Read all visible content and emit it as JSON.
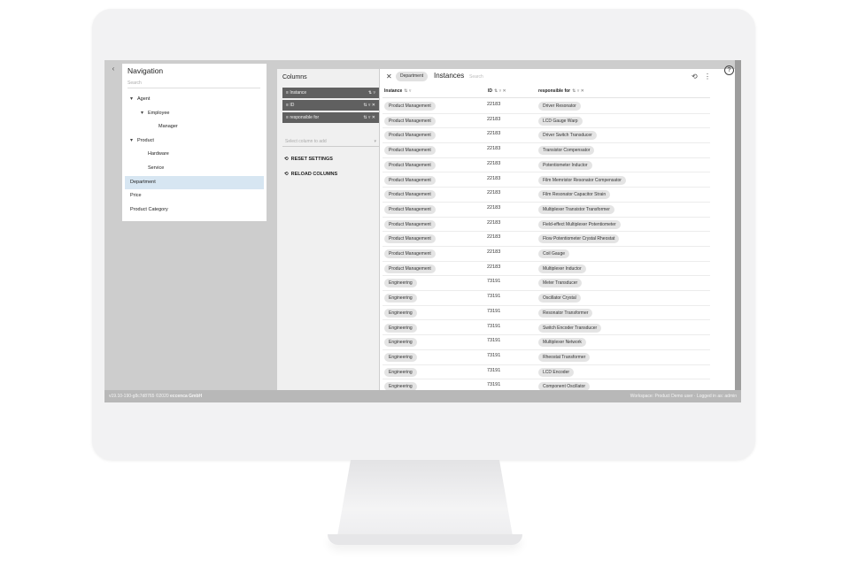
{
  "app": {
    "collapse_icon": "chevron-left-icon",
    "footer_left_version": "v19.10-190-g8c7d8765 ©2020",
    "footer_left_company": "eccenca GmbH",
    "footer_right": "Workspace: Product Demo user · Logged in as: admin",
    "help_icon": "help-circle-icon"
  },
  "navigation": {
    "title": "Navigation",
    "search_placeholder": "Search",
    "items": [
      {
        "label": "Agent",
        "expander": "▾",
        "indent": 0
      },
      {
        "label": "Employee",
        "expander": "▾",
        "indent": 1
      },
      {
        "label": "Manager",
        "expander": "",
        "indent": 2
      },
      {
        "label": "Product",
        "expander": "▾",
        "indent": 0
      },
      {
        "label": "Hardware",
        "expander": "",
        "indent": 1
      },
      {
        "label": "Service",
        "expander": "",
        "indent": 1
      },
      {
        "label": "Department",
        "expander": "",
        "indent": 0,
        "active": true
      },
      {
        "label": "Price",
        "expander": "",
        "indent": 0
      },
      {
        "label": "Product Category",
        "expander": "",
        "indent": 0
      }
    ]
  },
  "columns": {
    "title": "Columns",
    "chips": [
      {
        "label": "Instance",
        "controls": "⇅ ▿"
      },
      {
        "label": "ID",
        "controls": "⇅ ▿ ✕"
      },
      {
        "label": "responsible for",
        "controls": "⇅ ▿ ✕"
      }
    ],
    "select_placeholder": "Select column to add",
    "reset_label": "RESET SETTINGS",
    "reload_label": "RELOAD COLUMNS"
  },
  "instances": {
    "filter_chip": "Department",
    "title": "Instances",
    "search_placeholder": "Search",
    "headers": [
      "Instance",
      "ID",
      "responsible for"
    ],
    "header_icons": [
      "⇅ ▿",
      "⇅ ▿ ✕",
      "⇅ ▿ ✕"
    ],
    "rows": [
      {
        "instance": "Product Management",
        "id": "22183",
        "responsible": "Driver Resonator"
      },
      {
        "instance": "Product Management",
        "id": "22183",
        "responsible": "LCD Gauge Warp"
      },
      {
        "instance": "Product Management",
        "id": "22183",
        "responsible": "Driver Switch Transducer"
      },
      {
        "instance": "Product Management",
        "id": "22183",
        "responsible": "Transistor Compensator"
      },
      {
        "instance": "Product Management",
        "id": "22183",
        "responsible": "Potentiometer Inductor"
      },
      {
        "instance": "Product Management",
        "id": "22183",
        "responsible": "Film Memristor Resonator Compensator"
      },
      {
        "instance": "Product Management",
        "id": "22183",
        "responsible": "Film Resonator Capacitor Strain"
      },
      {
        "instance": "Product Management",
        "id": "22183",
        "responsible": "Multiplexer Transistor Transformer"
      },
      {
        "instance": "Product Management",
        "id": "22183",
        "responsible": "Field-effect Multiplexer Potentiometer"
      },
      {
        "instance": "Product Management",
        "id": "22183",
        "responsible": "Flow Potentiometer Crystal Rheostat"
      },
      {
        "instance": "Product Management",
        "id": "22183",
        "responsible": "Coil Gauge"
      },
      {
        "instance": "Product Management",
        "id": "22183",
        "responsible": "Multiplexer Inductor"
      },
      {
        "instance": "Engineering",
        "id": "73191",
        "responsible": "Meter Transducer"
      },
      {
        "instance": "Engineering",
        "id": "73191",
        "responsible": "Oscillator Crystal"
      },
      {
        "instance": "Engineering",
        "id": "73191",
        "responsible": "Resonator Transformer"
      },
      {
        "instance": "Engineering",
        "id": "73191",
        "responsible": "Switch Encoder Transducer"
      },
      {
        "instance": "Engineering",
        "id": "73191",
        "responsible": "Multiplexer Network"
      },
      {
        "instance": "Engineering",
        "id": "73191",
        "responsible": "Rheostat Transformer"
      },
      {
        "instance": "Engineering",
        "id": "73191",
        "responsible": "LCD Encoder"
      },
      {
        "instance": "Engineering",
        "id": "73191",
        "responsible": "Component Oscillator"
      }
    ]
  }
}
